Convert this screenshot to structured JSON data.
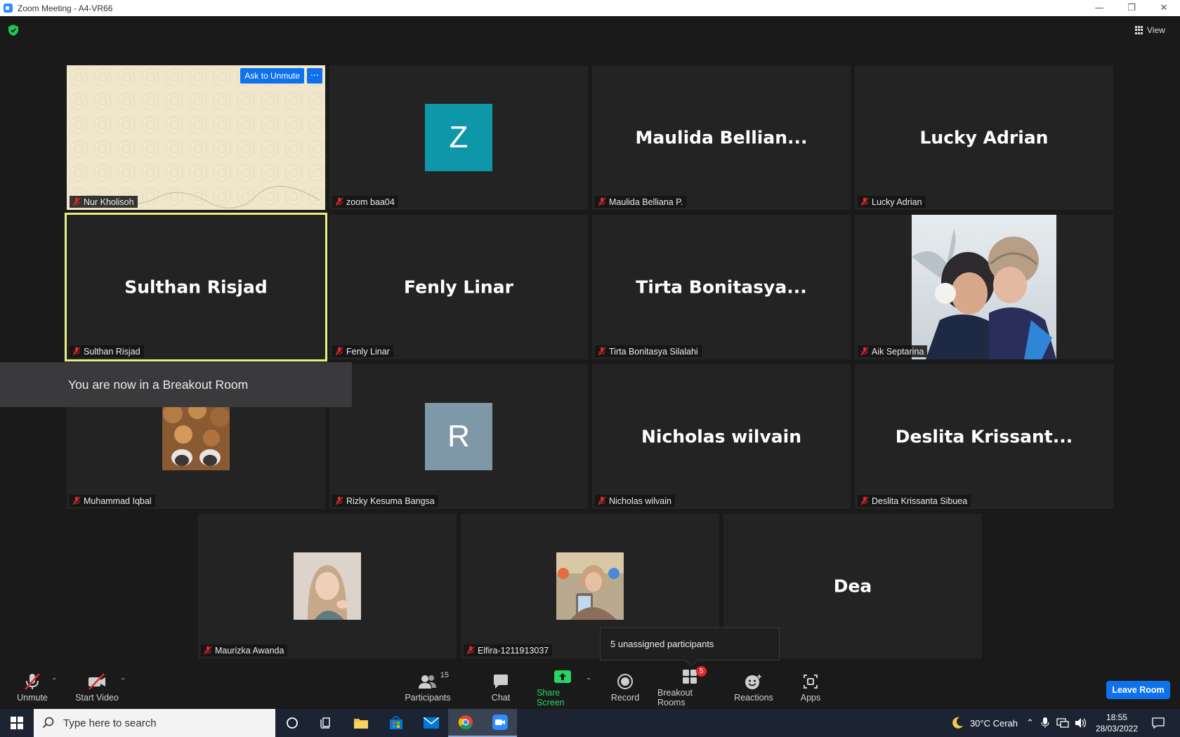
{
  "window": {
    "title": "Zoom Meeting - A4-VR66"
  },
  "topbar": {
    "view_label": "View"
  },
  "tiles": [
    {
      "id": "nur",
      "tag": "Nur Kholisoh",
      "ask_unmute": "Ask to Unmute",
      "more": "···"
    },
    {
      "id": "zoom",
      "tag": "zoom baa04",
      "letter": "Z",
      "color": "#0e97a8"
    },
    {
      "id": "maulida",
      "tag": "Maulida Belliana P.",
      "display": "Maulida  Bellian..."
    },
    {
      "id": "lucky",
      "tag": "Lucky Adrian",
      "display": "Lucky Adrian"
    },
    {
      "id": "sulthan",
      "tag": "Sulthan Risjad",
      "display": "Sulthan Risjad"
    },
    {
      "id": "fenly",
      "tag": "Fenly Linar",
      "display": "Fenly Linar"
    },
    {
      "id": "tirta",
      "tag": "Tirta Bonitasya Silalahi",
      "display": "Tirta  Bonitasya..."
    },
    {
      "id": "aik",
      "tag": "Aik Septarina"
    },
    {
      "id": "muhammad",
      "tag": "Muhammad Iqbal"
    },
    {
      "id": "rizky",
      "tag": "Rizky Kesuma Bangsa",
      "letter": "R",
      "color": "#7f98a8"
    },
    {
      "id": "nicholas",
      "tag": "Nicholas wilvain",
      "display": "Nicholas wilvain"
    },
    {
      "id": "deslita",
      "tag": "Deslita Krissanta Sibuea",
      "display": "Deslita  Krissant..."
    },
    {
      "id": "maurizka",
      "tag": "Maurizka Awanda"
    },
    {
      "id": "elfira",
      "tag": "Elfira-1211913037"
    },
    {
      "id": "dea",
      "display": "Dea"
    }
  ],
  "toast": {
    "text": "You are now in a Breakout Room"
  },
  "tooltip": {
    "text": "5 unassigned participants"
  },
  "toolbar": {
    "unmute": "Unmute",
    "start_video": "Start Video",
    "participants": "Participants",
    "participants_count": "15",
    "chat": "Chat",
    "share_screen": "Share Screen",
    "record": "Record",
    "breakout_rooms": "Breakout Rooms",
    "breakout_badge": "5",
    "reactions": "Reactions",
    "apps": "Apps",
    "leave_room": "Leave Room"
  },
  "taskbar": {
    "search_placeholder": "Type here to search",
    "weather": "30°C  Cerah",
    "time": "18:55",
    "date": "28/03/2022"
  },
  "colors": {
    "accent": "#0e72ed",
    "share_green": "#29d365",
    "active_speaker": "#e6f07e",
    "badge_red": "#e02828"
  }
}
